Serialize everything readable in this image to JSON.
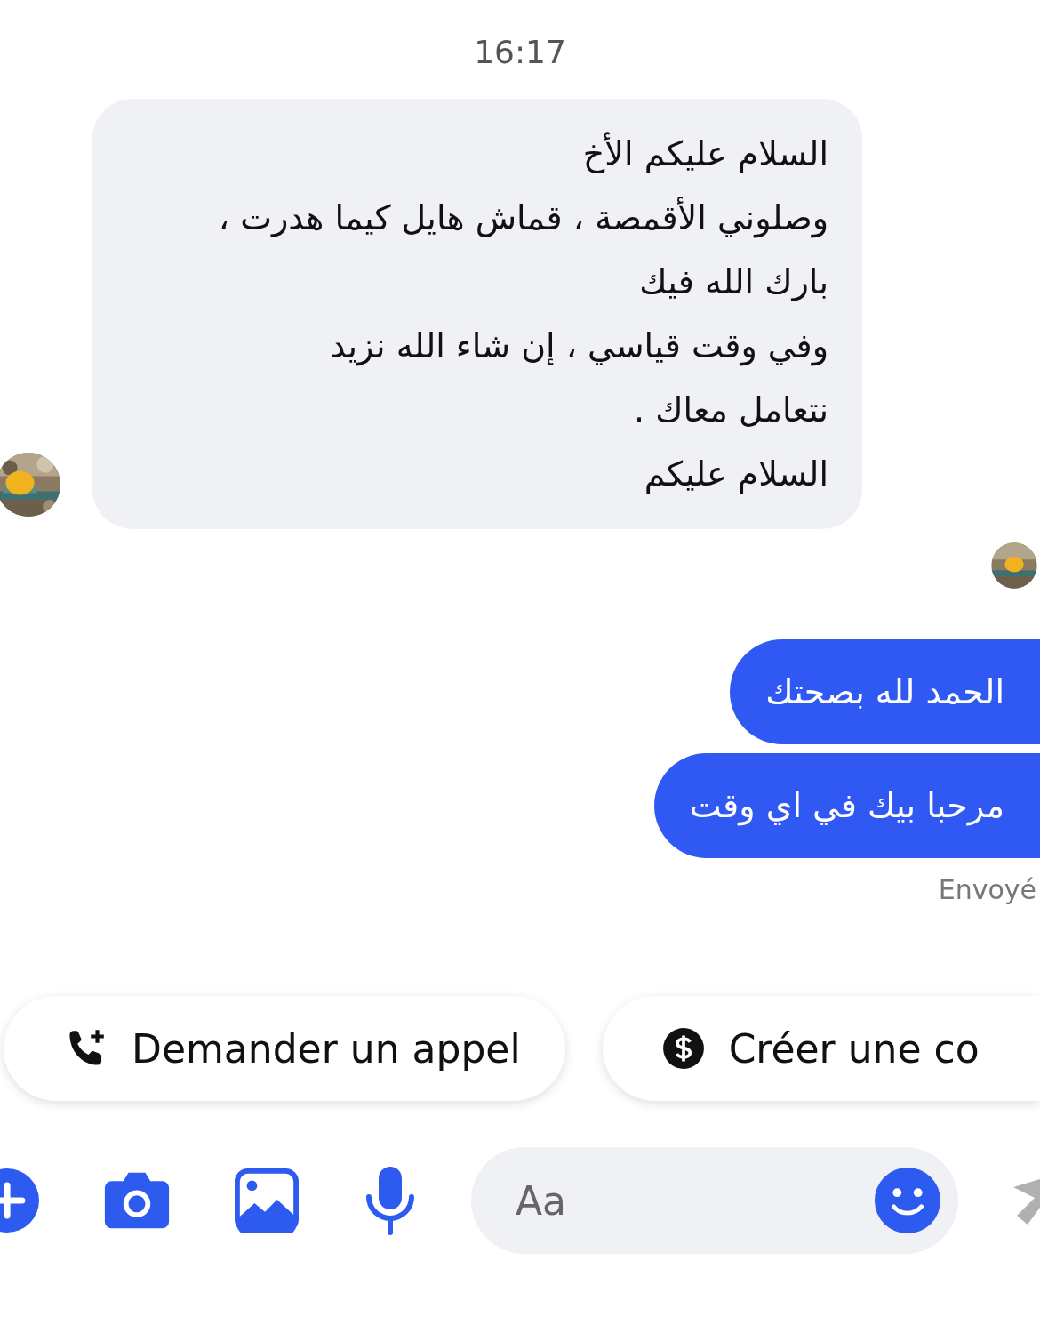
{
  "time": "16:17",
  "received": {
    "lines": [
      "السلام عليكم الأخ",
      "وصلوني الأقمصة ، قماش هايل كيما هدرت ،",
      "بارك الله فيك",
      "وفي وقت قياسي ، إن شاء الله نزيد",
      "نتعامل معاك .",
      "السلام عليكم"
    ]
  },
  "sent": [
    {
      "text": "الحمد لله بصحتك"
    },
    {
      "text": "مرحبا بيك في اي وقت"
    }
  ],
  "status": "Envoyé",
  "call_chip": {
    "label": "Demander un appel"
  },
  "payment_chip": {
    "label": "Créer une co"
  },
  "composer": {
    "placeholder": "Aa"
  }
}
